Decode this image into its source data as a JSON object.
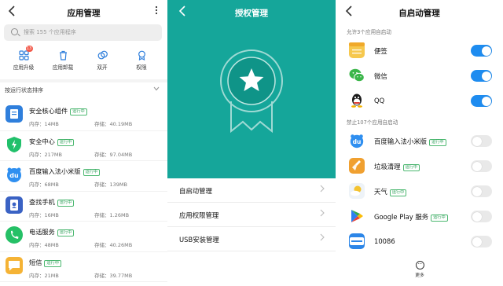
{
  "colors": {
    "teal": "#15a69a",
    "toggle_on": "#1e8cf0",
    "running_tag": "#2fa05a"
  },
  "app_manager": {
    "title": "应用管理",
    "back_icon": "back-arrow-icon",
    "more_icon": "more-vertical-icon",
    "search_placeholder": "搜索 155 个应用程序",
    "tools": [
      {
        "label": "应用升级",
        "icon": "app-upgrade-icon",
        "badge": "13"
      },
      {
        "label": "应用卸载",
        "icon": "trash-icon"
      },
      {
        "label": "双开",
        "icon": "dual-app-icon"
      },
      {
        "label": "权限",
        "icon": "permission-icon"
      }
    ],
    "sort_label": "按运行状态排序",
    "apps": [
      {
        "name": "安全核心组件",
        "tag": "运行中",
        "memory": "内存：14MB",
        "storage": "存储：40.19MB",
        "icon": "security-core-icon",
        "color": "#2f7fdc"
      },
      {
        "name": "安全中心",
        "tag": "运行中",
        "memory": "内存：217MB",
        "storage": "存储：97.04MB",
        "icon": "security-center-icon",
        "color": "#21c06b"
      },
      {
        "name": "百度输入法小米版",
        "tag": "运行中",
        "memory": "内存：68MB",
        "storage": "存储：139MB",
        "icon": "baidu-input-icon",
        "color": "#2f8ff0"
      },
      {
        "name": "查找手机",
        "tag": "运行中",
        "memory": "内存：16MB",
        "storage": "存储：1.26MB",
        "icon": "find-phone-icon",
        "color": "#3a62c4"
      },
      {
        "name": "电话服务",
        "tag": "运行中",
        "memory": "内存：48MB",
        "storage": "存储：40.26MB",
        "icon": "phone-icon",
        "color": "#25c066"
      },
      {
        "name": "短信",
        "tag": "运行中",
        "memory": "内存：21MB",
        "storage": "存储：39.77MB",
        "icon": "sms-icon",
        "color": "#f5b335"
      }
    ]
  },
  "authorization": {
    "title": "授权管理",
    "back_icon": "back-arrow-icon",
    "medal_icon": "star-badge-icon",
    "menu": [
      {
        "label": "自启动管理"
      },
      {
        "label": "应用权限管理"
      },
      {
        "label": "USB安装管理"
      }
    ]
  },
  "autostart": {
    "title": "自启动管理",
    "back_icon": "back-arrow-icon",
    "allowed_label": "允许3个应用自启动",
    "allowed": [
      {
        "name": "便签",
        "icon": "notes-icon",
        "color": "#f6c84e",
        "on": true
      },
      {
        "name": "微信",
        "icon": "wechat-icon",
        "color": "#3bb64a",
        "on": true
      },
      {
        "name": "QQ",
        "icon": "qq-icon",
        "color": "#1a1a1a",
        "on": true
      }
    ],
    "denied_label": "禁止107个应用自启动",
    "denied": [
      {
        "name": "百度输入法小米版",
        "tag": "运行中",
        "icon": "baidu-input-icon",
        "color": "#2f8ff0",
        "on": false
      },
      {
        "name": "垃圾清理",
        "tag": "运行中",
        "icon": "cleaner-icon",
        "color": "#f0a030",
        "on": false
      },
      {
        "name": "天气",
        "tag": "运行中",
        "icon": "weather-icon",
        "color": "#f4c330",
        "on": false
      },
      {
        "name": "Google Play 服务",
        "tag": "运行中",
        "icon": "google-play-icon",
        "color": "#34a853",
        "on": false
      },
      {
        "name": "10086",
        "icon": "china-mobile-10086-icon",
        "color": "#2c86e8",
        "on": false
      }
    ],
    "more_label": "更多",
    "more_icon": "more-circle-icon"
  }
}
